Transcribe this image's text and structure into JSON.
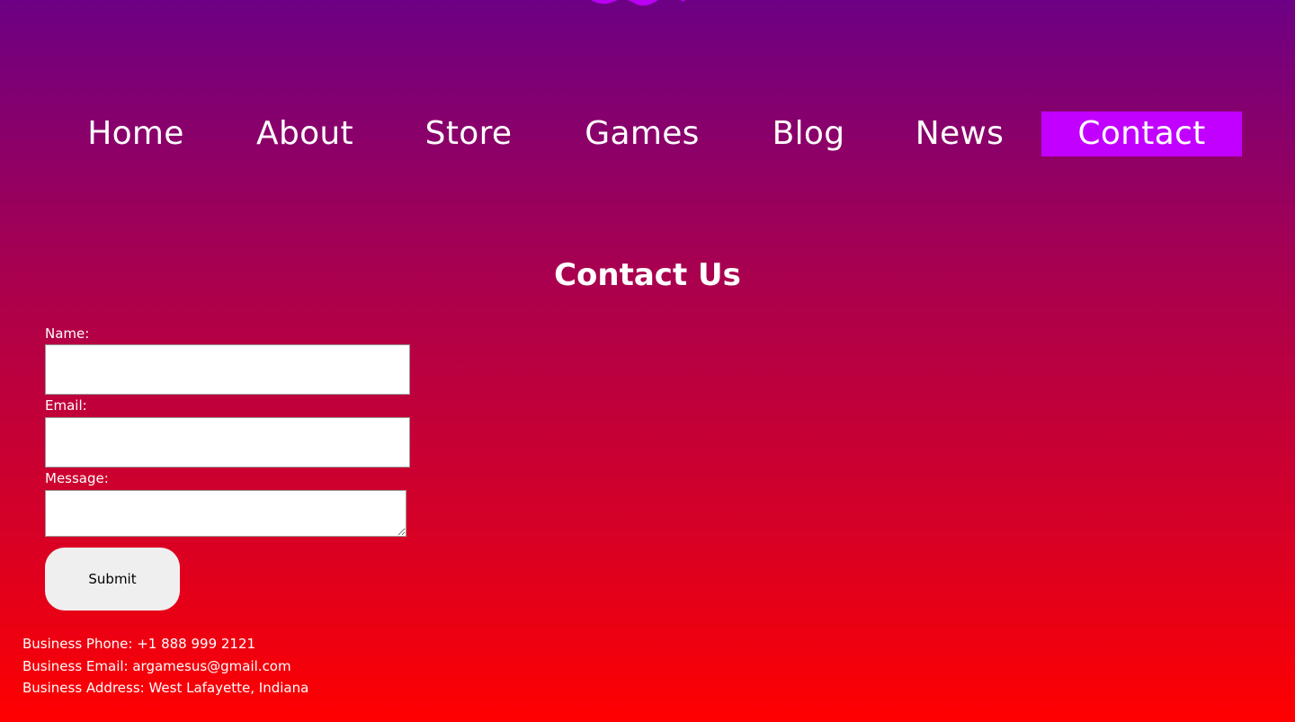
{
  "nav": {
    "items": [
      "Home",
      "About",
      "Store",
      "Games",
      "Blog",
      "News",
      "Contact"
    ],
    "active": "Contact",
    "active_color": "#c100ff"
  },
  "page": {
    "title": "Contact Us"
  },
  "form": {
    "name_label": "Name:",
    "email_label": "Email:",
    "message_label": "Message:",
    "submit_label": "Submit"
  },
  "business": {
    "phone": "Business Phone: +1 888 999 2121",
    "email": "Business Email: argamesus@gmail.com",
    "address": "Business Address: West Lafayette, Indiana"
  },
  "colors": {
    "gradient_top": "#6c0084",
    "gradient_bottom": "#ff0000",
    "logo_accent": "#c100ff"
  },
  "icons": {
    "logo": "logo-emblem"
  }
}
